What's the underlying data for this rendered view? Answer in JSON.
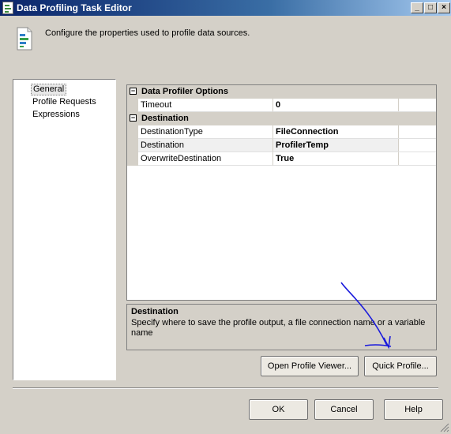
{
  "window": {
    "title": "Data Profiling Task Editor",
    "controls": {
      "minimize": "_",
      "maximize": "□",
      "close": "×"
    }
  },
  "header": {
    "icon": "profiler-task-icon",
    "text": "Configure the properties used to profile data sources."
  },
  "nav": {
    "items": [
      {
        "label": "General",
        "selected": true
      },
      {
        "label": "Profile Requests",
        "selected": false
      },
      {
        "label": "Expressions",
        "selected": false
      }
    ]
  },
  "grid": {
    "categories": [
      {
        "label": "Data Profiler Options",
        "toggle": "−",
        "rows": [
          {
            "name": "Timeout",
            "value": "0"
          }
        ]
      },
      {
        "label": "Destination",
        "toggle": "−",
        "rows": [
          {
            "name": "DestinationType",
            "value": "FileConnection"
          },
          {
            "name": "Destination",
            "value": "ProfilerTemp"
          },
          {
            "name": "OverwriteDestination",
            "value": "True"
          }
        ]
      }
    ]
  },
  "description": {
    "title": "Destination",
    "text": "Specify where to save the profile output, a file connection name or a variable name"
  },
  "buttons": {
    "open_profile_viewer": "Open Profile Viewer...",
    "quick_profile": "Quick Profile...",
    "ok": "OK",
    "cancel": "Cancel",
    "help": "Help"
  },
  "colors": {
    "title_gradient_start": "#0a246a",
    "dialog_face": "#d4d0c8",
    "annotation_arrow": "#1a1adc"
  }
}
